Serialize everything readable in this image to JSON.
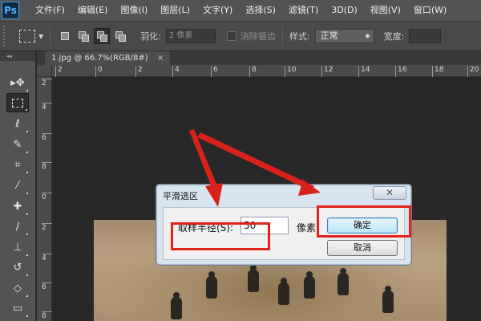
{
  "app": {
    "logo": "Ps"
  },
  "menu": [
    "文件(F)",
    "编辑(E)",
    "图像(I)",
    "图层(L)",
    "文字(Y)",
    "选择(S)",
    "滤镜(T)",
    "3D(D)",
    "视图(V)",
    "窗口(W)"
  ],
  "options": {
    "feather_label": "羽化:",
    "feather_value": "2 像素",
    "antialias_label": "消除锯齿",
    "style_label": "样式:",
    "style_value": "正常",
    "width_label": "宽度:"
  },
  "toolbox": {
    "header": "◂◂",
    "tools": [
      {
        "name": "move-tool",
        "icon": "move-icon",
        "glyph": "▸✥"
      },
      {
        "name": "rect-marquee-tool",
        "icon": "rect-marquee-icon",
        "glyph": ""
      },
      {
        "name": "lasso-tool",
        "icon": "lasso-icon",
        "glyph": "ℓ"
      },
      {
        "name": "quick-select-tool",
        "icon": "quick-select-icon",
        "glyph": "✎"
      },
      {
        "name": "crop-tool",
        "icon": "crop-icon",
        "glyph": "⌗"
      },
      {
        "name": "eyedropper-tool",
        "icon": "eyedropper-icon",
        "glyph": "⁄"
      },
      {
        "name": "healing-brush-tool",
        "icon": "healing-brush-icon",
        "glyph": "✚"
      },
      {
        "name": "brush-tool",
        "icon": "brush-icon",
        "glyph": "∕"
      },
      {
        "name": "clone-stamp-tool",
        "icon": "clone-stamp-icon",
        "glyph": "⊥"
      },
      {
        "name": "history-brush-tool",
        "icon": "history-brush-icon",
        "glyph": "↺"
      },
      {
        "name": "eraser-tool",
        "icon": "eraser-icon",
        "glyph": "◇"
      },
      {
        "name": "gradient-tool",
        "icon": "gradient-icon",
        "glyph": "▭"
      }
    ]
  },
  "document": {
    "tab_title": "1.jpg @ 66.7%(RGB/8#)",
    "close_glyph": "×"
  },
  "ruler_h": [
    "2",
    "0",
    "2",
    "4",
    "6",
    "8",
    "10",
    "12",
    "14",
    "16",
    "18",
    "20"
  ],
  "ruler_v": [
    "2",
    "4",
    "6",
    "8",
    "0",
    "2",
    "4",
    "6",
    "8"
  ],
  "dialog": {
    "title": "平滑选区",
    "close_glyph": "✕",
    "radius_label": "取样半径(S):",
    "radius_value": "50",
    "unit": "像素",
    "ok_label": "确定",
    "cancel_label": "取消"
  },
  "colors": {
    "highlight": "#e2231a",
    "ps_blue": "#4fb3ff",
    "dialog_bg": "#d9e4f1"
  }
}
